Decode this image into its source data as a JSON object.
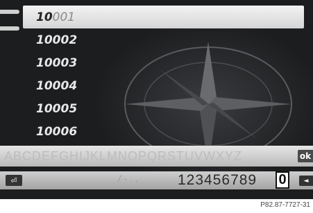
{
  "list": {
    "selected": {
      "typed": "10",
      "completion": "001"
    },
    "items": [
      "10002",
      "10003",
      "10004",
      "10005",
      "10006"
    ]
  },
  "keyboard": {
    "alphabet": "ABCDEFGHIJKLMNOPQRSTUVWXYZ",
    "ok_label": "ok",
    "digits": "123456789",
    "cursor_digit": "0"
  },
  "reference": "P82.87-7727-31",
  "colors": {
    "screen_bg": "#1c1d1f",
    "highlight": "#e8e8e8"
  },
  "icons": {
    "back": "back-arrow-icon",
    "delete": "delete-icon"
  }
}
